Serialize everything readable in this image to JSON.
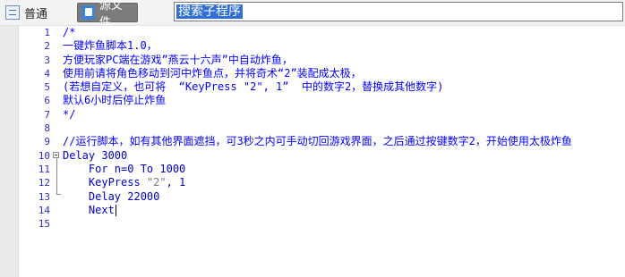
{
  "tabs": [
    {
      "label": "普通",
      "icon": "document-icon",
      "active": false
    },
    {
      "label": "源文件",
      "icon": "source-file-icon",
      "active": true
    }
  ],
  "search": {
    "value": "搜索子程序"
  },
  "lines": [
    {
      "no": "1",
      "text": "/*",
      "kind": "comment"
    },
    {
      "no": "2",
      "text": "一键炸鱼脚本1.0，",
      "kind": "comment"
    },
    {
      "no": "3",
      "text": "方便玩家PC端在游戏”燕云十六声”中自动炸鱼，",
      "kind": "comment"
    },
    {
      "no": "4",
      "text": "使用前请将角色移动到河中炸鱼点，并将奇术“2”装配成太极，",
      "kind": "comment"
    },
    {
      "no": "5",
      "text": "(若想自定义，也可将  “KeyPress \"2\", 1”  中的数字2，替换成其他数字)",
      "kind": "comment"
    },
    {
      "no": "6",
      "text": "默认6小时后停止炸鱼",
      "kind": "comment"
    },
    {
      "no": "7",
      "text": "*/",
      "kind": "comment"
    },
    {
      "no": "8",
      "text": "",
      "kind": "blank"
    },
    {
      "no": "9",
      "text": "//运行脚本，如有其他界面遮挡，可3秒之内可手动切回游戏界面，之后通过按键数字2，开始使用太极炸鱼",
      "kind": "comment"
    },
    {
      "no": "10",
      "text": "Delay 3000",
      "kind": "code"
    },
    {
      "no": "11",
      "text": "    For n=0 To 1000",
      "kind": "code"
    },
    {
      "no": "12",
      "kw": "    KeyPress ",
      "str": "\"2\"",
      "rest": ", 1",
      "kind": "keypress"
    },
    {
      "no": "13",
      "text": "    Delay 22000",
      "kind": "code"
    },
    {
      "no": "14",
      "text": "    Next",
      "kind": "code",
      "caret": true
    },
    {
      "no": "15",
      "text": "",
      "kind": "blank"
    }
  ]
}
